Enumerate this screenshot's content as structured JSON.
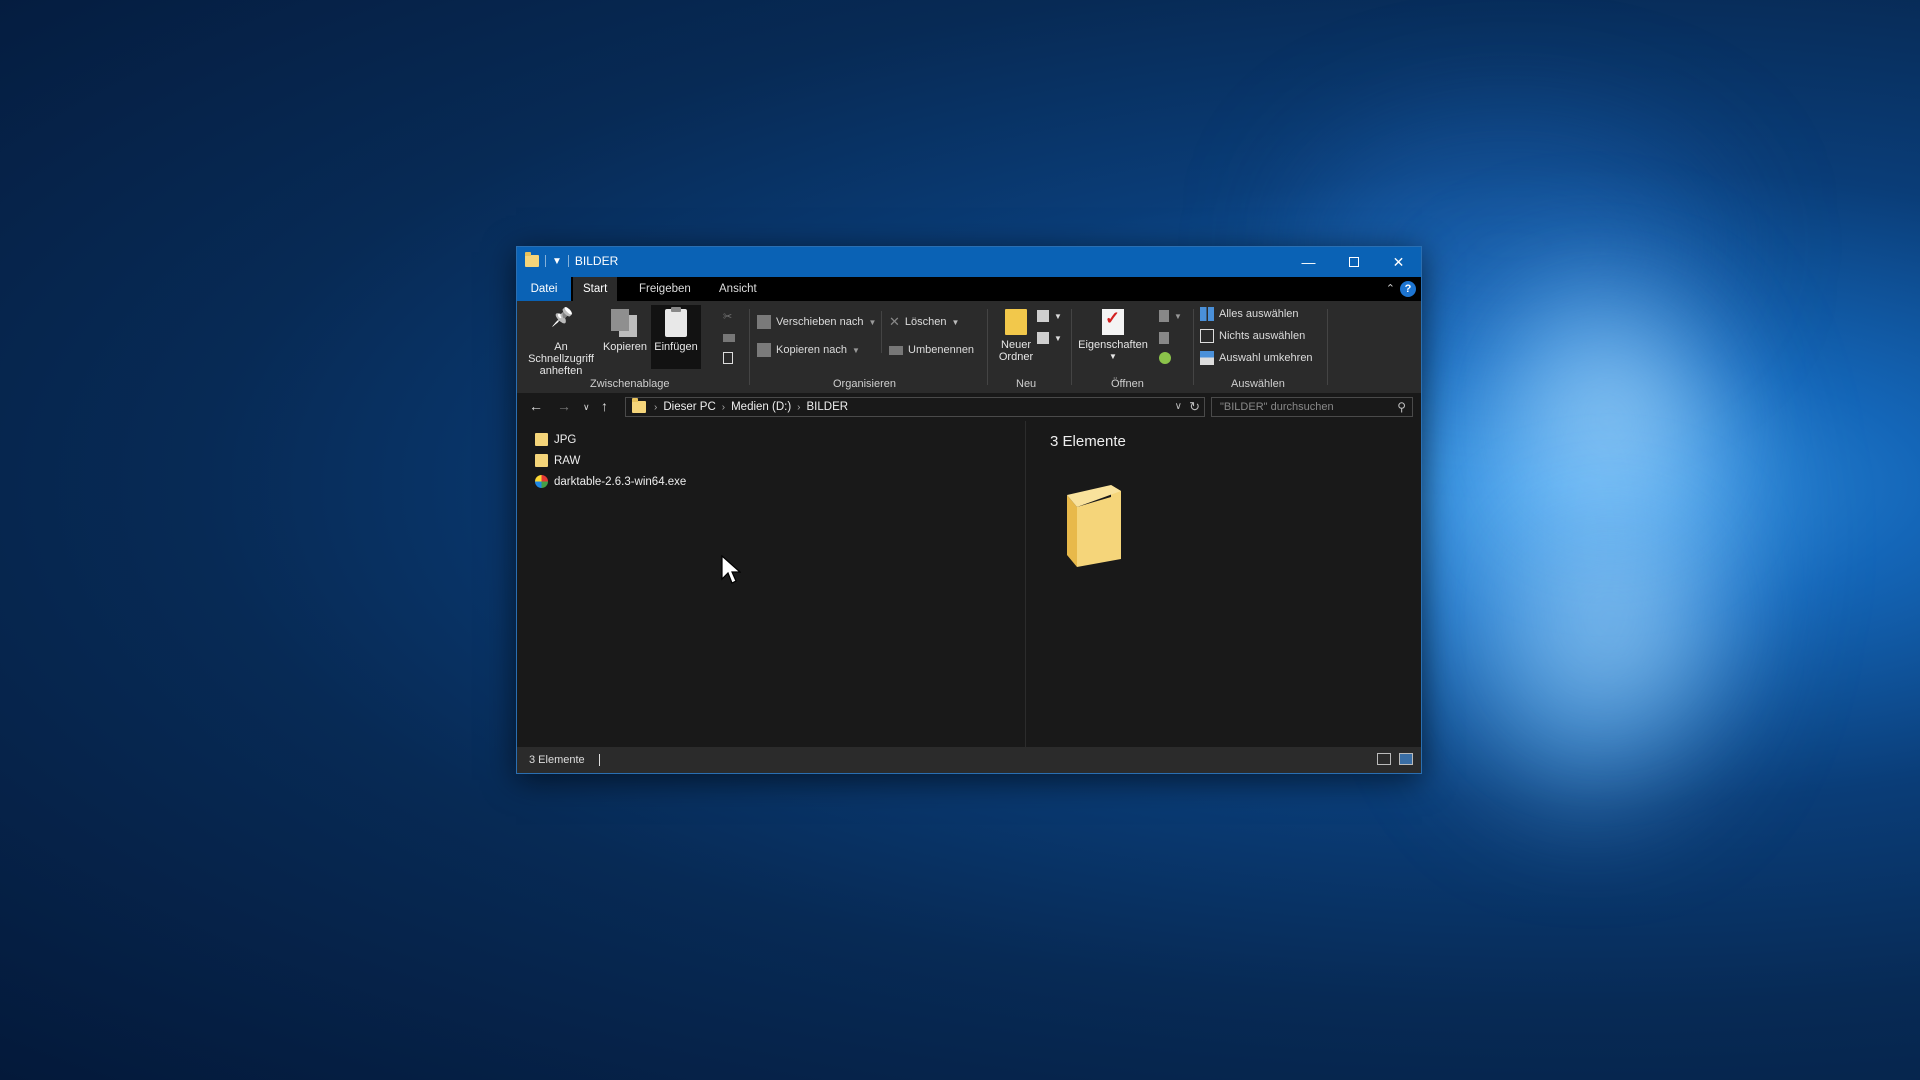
{
  "window": {
    "title": "BILDER",
    "controls": {
      "minimize": "—",
      "close": "✕"
    }
  },
  "ribbon_tabs": [
    {
      "label": "Datei"
    },
    {
      "label": "Start"
    },
    {
      "label": "Freigeben"
    },
    {
      "label": "Ansicht"
    }
  ],
  "help_label": "?",
  "ribbon": {
    "clipboard": {
      "group": "Zwischenablage",
      "pin_line1": "An Schnellzugriff",
      "pin_line2": "anheften",
      "copy": "Kopieren",
      "paste": "Einfügen"
    },
    "organize": {
      "group": "Organisieren",
      "move_to": "Verschieben nach",
      "copy_to": "Kopieren nach",
      "delete": "Löschen",
      "rename": "Umbenennen"
    },
    "new": {
      "group": "Neu",
      "new_folder_line1": "Neuer",
      "new_folder_line2": "Ordner"
    },
    "open": {
      "group": "Öffnen",
      "properties": "Eigenschaften"
    },
    "select": {
      "group": "Auswählen",
      "select_all": "Alles auswählen",
      "select_none": "Nichts auswählen",
      "invert": "Auswahl umkehren"
    }
  },
  "address": {
    "crumbs": [
      "Dieser PC",
      "Medien (D:)",
      "BILDER"
    ],
    "search_placeholder": "\"BILDER\" durchsuchen"
  },
  "files": [
    {
      "name": "JPG",
      "type": "folder"
    },
    {
      "name": "RAW",
      "type": "folder"
    },
    {
      "name": "darktable-2.6.3-win64.exe",
      "type": "exe"
    }
  ],
  "preview": {
    "title": "3 Elemente"
  },
  "status": {
    "text": "3 Elemente"
  },
  "colors": {
    "titlebar": "#0a62b5",
    "folder": "#f5d57a",
    "background": "#191919"
  }
}
